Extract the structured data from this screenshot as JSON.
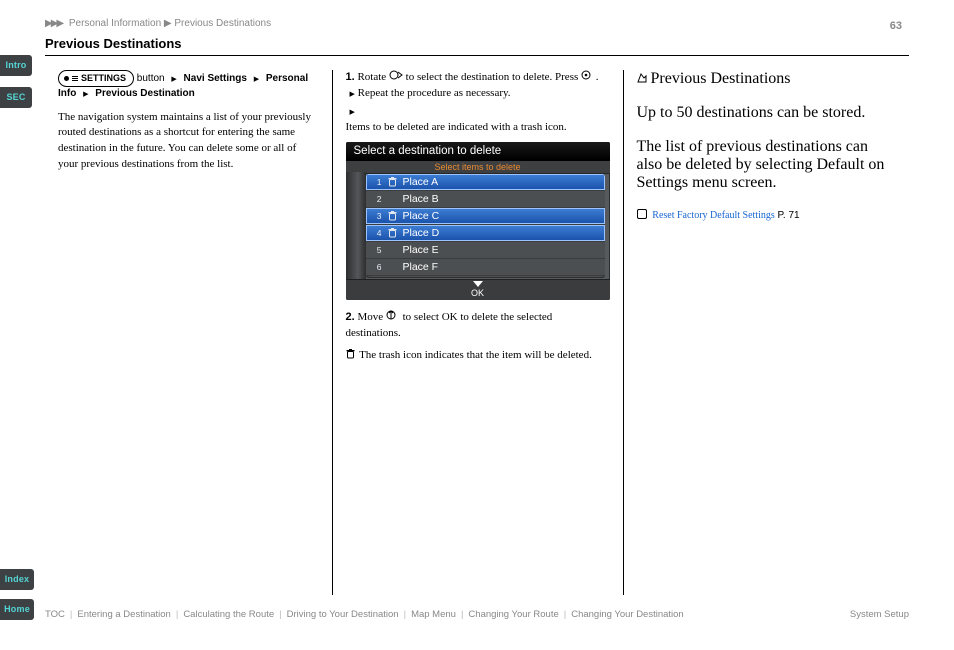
{
  "page_number": "63",
  "breadcrumb": {
    "arrows": "▶▶▶",
    "text": "Personal Information ▶ Previous Destinations"
  },
  "section_title": "Previous Destinations",
  "tabs": {
    "intro": "Intro",
    "sec": "SEC",
    "index": "Index",
    "home": "Home"
  },
  "menu_path": {
    "button": "SETTINGS",
    "seg1": "Navi Settings",
    "seg2": "Personal Info",
    "seg3": "Previous Destination"
  },
  "left": {
    "intro": "The navigation system maintains a list of your previously routed destinations as a shortcut for entering the same destination in the future. You can delete some or all of your previous destinations from the list.",
    "step1_label": "1.",
    "step1_text": "Rotate",
    "step1_text2": "to select the destination to delete. Press",
    "step1_text3": ".",
    "step1_tail": "Repeat the procedure as necessary.",
    "step1_note": "Items to be deleted are indicated with a trash icon.",
    "step2_label": "2.",
    "step2_text": "Move",
    "step2_text2": "to select OK to delete the selected destinations."
  },
  "right": {
    "heading": "Previous Destinations",
    "body": "Up to 50 destinations can be stored.",
    "xref_lead": "The list of previous destinations can also be deleted by selecting Default on Settings menu screen.",
    "xref_link": "Reset Factory Default Settings",
    "xref_page": "P. 71"
  },
  "screenshot": {
    "title": "Select a destination to delete",
    "subtitle": "Select items to delete",
    "rows": [
      {
        "n": "1",
        "name": "Place A",
        "selected": true,
        "trash": true
      },
      {
        "n": "2",
        "name": "Place B",
        "selected": false,
        "trash": false
      },
      {
        "n": "3",
        "name": "Place C",
        "selected": true,
        "trash": true
      },
      {
        "n": "4",
        "name": "Place D",
        "selected": true,
        "trash": true
      },
      {
        "n": "5",
        "name": "Place E",
        "selected": false,
        "trash": false
      },
      {
        "n": "6",
        "name": "Place F",
        "selected": false,
        "trash": false
      }
    ],
    "ok_label": "OK"
  },
  "toc": {
    "items": [
      "TOC",
      "Entering a Destination",
      "Calculating the Route",
      "Driving to Your Destination",
      "Map Menu",
      "Changing Your Route",
      "Changing Your Destination"
    ]
  },
  "vertical_section_label": "System Setup",
  "colors": {
    "teal_text": "#54d4d4",
    "sidebar_bg": "#3e4143",
    "link": "#1766d0"
  }
}
